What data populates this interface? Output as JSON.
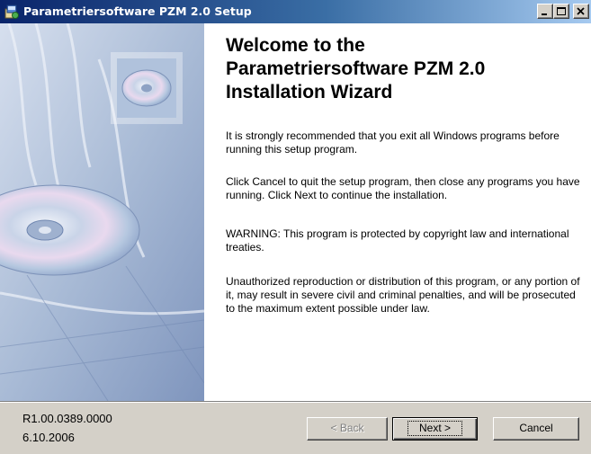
{
  "window": {
    "title": "Parametriersoftware PZM 2.0 Setup",
    "controls": {
      "minimize": "minimize-icon",
      "maximize": "maximize-icon",
      "close": "close-icon"
    }
  },
  "content": {
    "heading_line1": "Welcome to the",
    "heading_line2": "Parametriersoftware PZM 2.0",
    "heading_line3": "Installation Wizard",
    "para1": "It is strongly recommended that you exit all Windows programs before running this setup program.",
    "para2": "Click Cancel to quit the setup program, then close any programs you have running.  Click Next to continue the installation.",
    "para3": "WARNING: This program is protected by copyright law and international treaties.",
    "para4": "Unauthorized reproduction or distribution of this program, or any portion of it, may result in severe civil and criminal penalties, and will be prosecuted to the maximum extent possible under law."
  },
  "footer": {
    "version": "R1.00.0389.0000",
    "date": "6.10.2006",
    "back_label": "< Back",
    "next_label": "Next >",
    "cancel_label": "Cancel"
  },
  "colors": {
    "accent": "#0a246a",
    "side_panel": "#b8c6dc"
  }
}
